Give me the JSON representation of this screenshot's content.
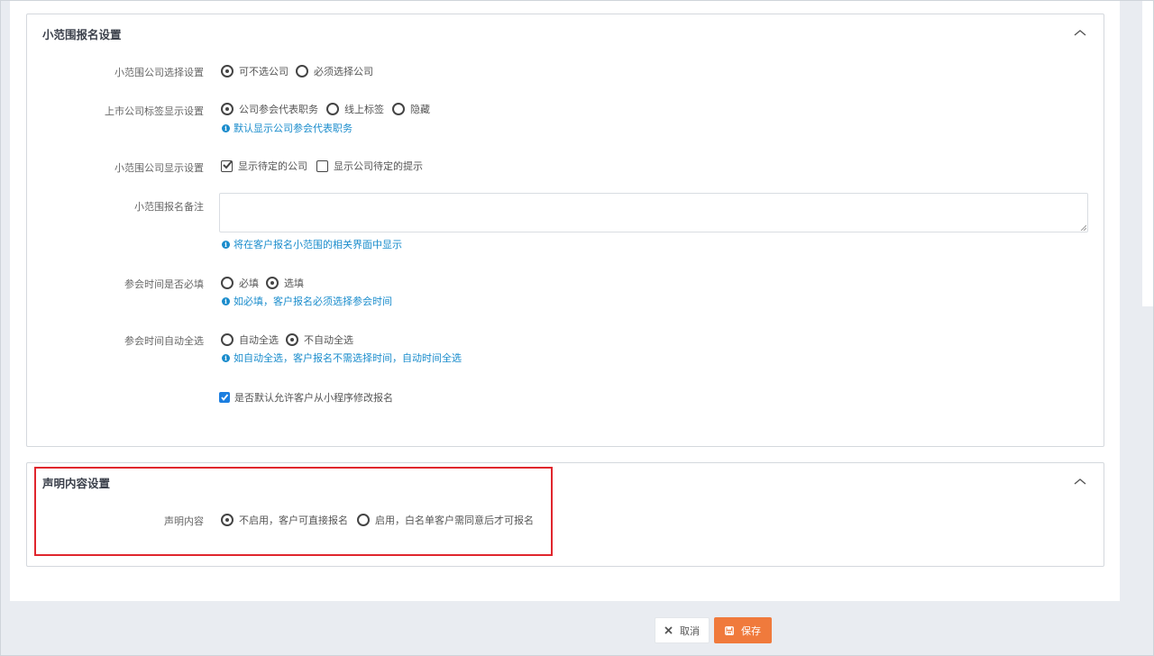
{
  "section_signup": {
    "title": "小范围报名设置",
    "company_select": {
      "label": "小范围公司选择设置",
      "options": [
        "可不选公司",
        "必须选择公司"
      ],
      "selected": "可不选公司"
    },
    "listed_tag": {
      "label": "上市公司标签显示设置",
      "options": [
        "公司参会代表职务",
        "线上标签",
        "隐藏"
      ],
      "selected": "公司参会代表职务",
      "hint": "默认显示公司参会代表职务"
    },
    "company_display": {
      "label": "小范围公司显示设置",
      "options": [
        "显示待定的公司",
        "显示公司待定的提示"
      ],
      "checked": [
        "显示待定的公司"
      ]
    },
    "remark": {
      "label": "小范围报名备注",
      "value": "",
      "hint": "将在客户报名小范围的相关界面中显示"
    },
    "time_required": {
      "label": "参会时间是否必填",
      "options": [
        "必填",
        "选填"
      ],
      "selected": "选填",
      "hint": "如必填，客户报名必须选择参会时间"
    },
    "time_autoselect": {
      "label": "参会时间自动全选",
      "options": [
        "自动全选",
        "不自动全选"
      ],
      "selected": "不自动全选",
      "hint": "如自动全选，客户报名不需选择时间，自动时间全选"
    },
    "allow_modify": {
      "label": "是否默认允许客户从小程序修改报名",
      "checked": true
    }
  },
  "section_statement": {
    "title": "声明内容设置",
    "content": {
      "label": "声明内容",
      "options": [
        "不启用，客户可直接报名",
        "启用，白名单客户需同意后才可报名"
      ],
      "selected": "不启用，客户可直接报名"
    }
  },
  "footer": {
    "cancel_label": "取消",
    "save_label": "保存"
  },
  "colors": {
    "accent_save": "#f07a3c",
    "hint_blue": "#1a8ccc",
    "checkbox_blue": "#1b7ee0",
    "highlight_red": "#e0262d"
  },
  "icons": [
    "chevron-up-icon",
    "info-icon",
    "close-icon",
    "save-icon",
    "checkmark-icon"
  ]
}
